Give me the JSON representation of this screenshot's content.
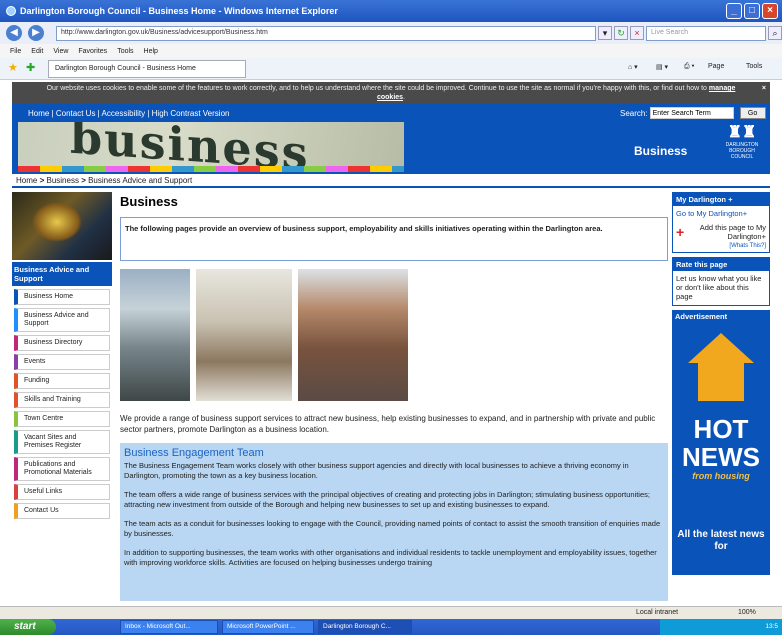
{
  "window": {
    "title": "Darlington Borough Council - Business Home - Windows Internet Explorer"
  },
  "address": {
    "url": "http://www.darlington.gov.uk/Business/advicesupport/Business.htm",
    "search_placeholder": "Live Search"
  },
  "menu": [
    "File",
    "Edit",
    "View",
    "Favorites",
    "Tools",
    "Help"
  ],
  "tab": {
    "label": "Darlington Borough Council - Business Home"
  },
  "commands": {
    "page": "Page",
    "tools": "Tools"
  },
  "cookie": {
    "text": "Our website uses cookies to enable some of the features to work correctly, and to help us understand where the site could be improved. Continue to use the site as normal if you're happy with this, or find out how to",
    "link": "manage cookies",
    "close": "×"
  },
  "toplinks": [
    "Home",
    "Contact Us",
    "Accessibility",
    "High Contrast Version"
  ],
  "site_search": {
    "label": "Search:",
    "placeholder": "Enter Search Term",
    "button": "Go"
  },
  "banner": {
    "word": "business",
    "title": "Business",
    "logo_text": "DARLINGTON BOROUGH COUNCIL"
  },
  "breadcrumb": {
    "home": "Home",
    "business": "Business",
    "current": "Business Advice and Support",
    "sep": ">"
  },
  "sidebar": {
    "heading": "Business Advice and Support",
    "items": [
      {
        "label": "Business Home",
        "color": "#0a53b8"
      },
      {
        "label": "Business Advice and Support",
        "color": "#1e90ff"
      },
      {
        "label": "Business Directory",
        "color": "#c0267a"
      },
      {
        "label": "Events",
        "color": "#8a3fa8"
      },
      {
        "label": "Funding",
        "color": "#e0522a"
      },
      {
        "label": "Skills and Training",
        "color": "#e0522a"
      },
      {
        "label": "Town Centre",
        "color": "#8ac43f"
      },
      {
        "label": "Vacant Sites and Premises Register",
        "color": "#1a9b8a"
      },
      {
        "label": "Publications and Promotional Materials",
        "color": "#c0267a"
      },
      {
        "label": "Useful Links",
        "color": "#d94040"
      },
      {
        "label": "Contact Us",
        "color": "#f0a020"
      }
    ]
  },
  "main": {
    "title": "Business",
    "intro": "The following pages provide an overview of business support, employability and skills initiatives operating within the Darlington area.",
    "description": "We provide a range of business support services to attract new business, help existing businesses to expand, and in partnership with private and public sector partners, promote Darlington as a business location.",
    "panel": {
      "heading": "Business Engagement Team",
      "paragraphs": [
        "The Business Engagement Team works closely with other business support agencies and directly with local businesses to achieve a thriving economy in Darlington, promoting the town as a key business location.",
        "The team offers a wide range of business services with the principal objectives of creating and protecting jobs in Darlington; stimulating business opportunities; attracting new investment from outside of the Borough and helping new businesses to set up and existing businesses to expand.",
        "The team acts as a conduit for businesses looking to engage with the Council, providing named points of contact to assist the smooth transition of enquiries made by businesses.",
        "In addition to supporting businesses, the team works with other organisations and individual residents to tackle unemployment and employability issues, together with improving workforce skills.  Activities are focused on helping businesses undergo training"
      ]
    }
  },
  "right": {
    "mydarlington": {
      "heading": "My Darlington +",
      "link": "Go to My Darlington+",
      "add": "Add this page to My Darlington+",
      "why": "[Whats This?]"
    },
    "rate": {
      "heading": "Rate this page",
      "text": "Let us know what you like or don't like about this page"
    },
    "advert": {
      "heading": "Advertisement",
      "hot": "HOT",
      "news": "NEWS",
      "from": "from housing",
      "latest": "All the latest news for"
    }
  },
  "status": {
    "zone": "Local intranet",
    "zoom": "100%"
  },
  "taskbar": {
    "start": "start",
    "items": [
      "Inbox - Microsoft Out...",
      "Microsoft PowerPoint ...",
      "Darlington Borough C..."
    ],
    "clock": "13:5"
  }
}
